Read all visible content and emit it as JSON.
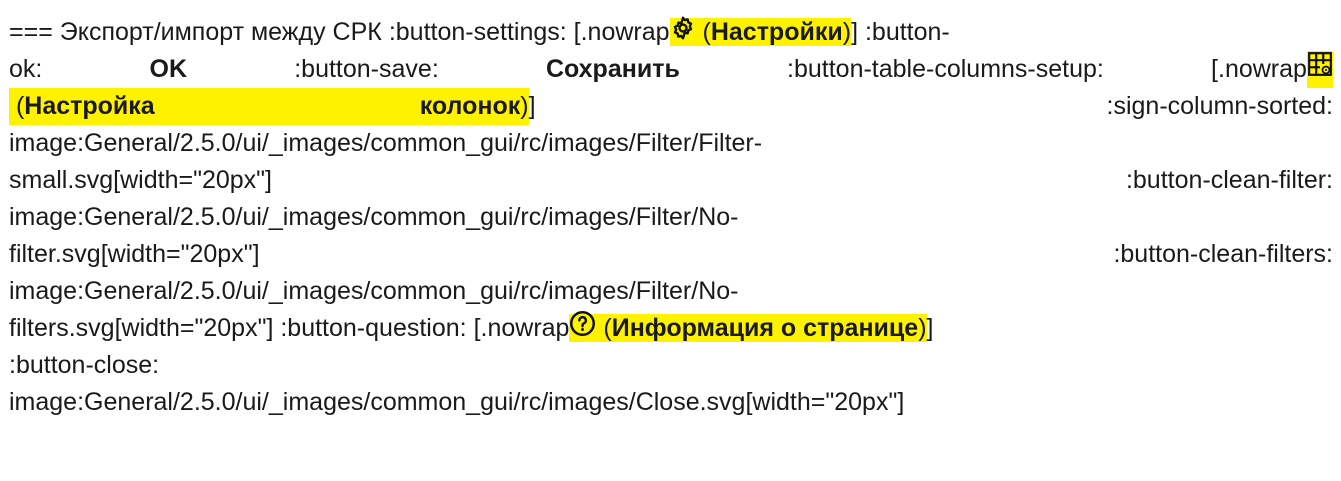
{
  "doc": {
    "heading_marker": "===",
    "heading_text": "Экспорт/импорт между СРК",
    "settings_attr": ":button-settings:",
    "nowrap": "[.nowrap",
    "open_paren": "(",
    "close_paren": ")",
    "close_bracket": "]",
    "settings_label": "Настройки",
    "button_ok_attr_a": ":button-",
    "button_ok_attr_b": "ok:",
    "ok_label": "OK",
    "save_attr": ":button-save:",
    "save_label": "Сохранить",
    "columns_setup_attr": ":button-table-columns-setup:",
    "columns_setup_label_a": "Настройка",
    "columns_setup_label_b": "колонок",
    "sign_sorted_attr": ":sign-column-sorted:",
    "filter_small_a": "image:General/2.5.0/ui/_images/common_gui/rc/images/Filter/Filter-",
    "filter_small_b": "small.svg[width=\"20px\"]",
    "clean_filter_attr": ":button-clean-filter:",
    "no_filter_a": "image:General/2.5.0/ui/_images/common_gui/rc/images/Filter/No-",
    "no_filter_b": "filter.svg[width=\"20px\"]",
    "clean_filters_attr": ":button-clean-filters:",
    "no_filters_a": "image:General/2.5.0/ui/_images/common_gui/rc/images/Filter/No-",
    "no_filters_b": "filters.svg[width=\"20px\"]",
    "question_attr": ":button-question:",
    "question_label": "Информация о странице",
    "close_attr": ":button-close:",
    "close_image": "image:General/2.5.0/ui/_images/common_gui/rc/images/Close.svg[width=\"20px\"]"
  },
  "icons": {
    "settings": "gear-icon",
    "columns": "table-columns-gear-icon",
    "question": "question-circle-icon"
  },
  "colors": {
    "highlight": "#fff200",
    "text": "#1a1a1a"
  }
}
